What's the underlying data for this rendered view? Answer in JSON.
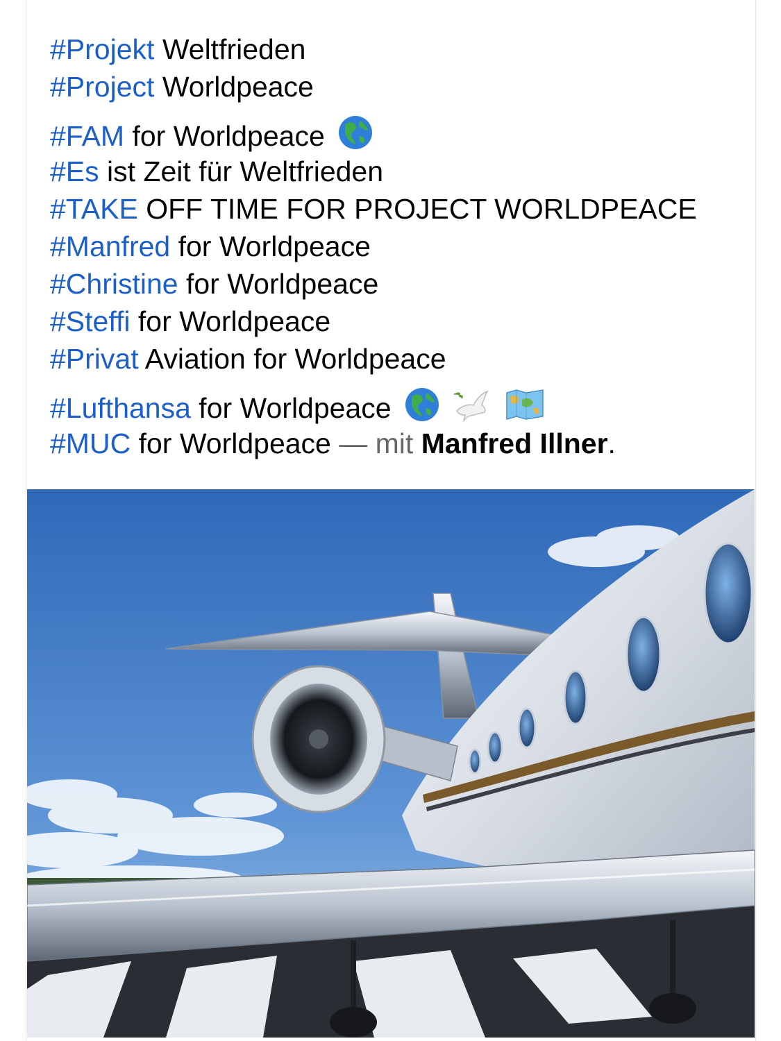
{
  "post": {
    "lines": [
      {
        "tag": "#Projekt",
        "rest": " Weltfrieden"
      },
      {
        "tag": "#Project",
        "rest": " Worldpeace"
      },
      {
        "tag": "#FAM",
        "rest": " for Worldpeace",
        "emojis": [
          "globe-americas-icon"
        ]
      },
      {
        "tag": "#Es",
        "rest": " ist Zeit für Weltfrieden"
      },
      {
        "tag": "#TAKE",
        "rest": " OFF TIME FOR PROJECT WORLDPEACE"
      },
      {
        "tag": "#Manfred",
        "rest": " for Worldpeace"
      },
      {
        "tag": "#Christine",
        "rest": " for Worldpeace"
      },
      {
        "tag": "#Steffi",
        "rest": " for Worldpeace"
      },
      {
        "tag": "#Privat",
        "rest": " Aviation for Worldpeace"
      },
      {
        "tag": "#Lufthansa",
        "rest": " for Worldpeace",
        "emojis": [
          "globe-americas-icon",
          "dove-icon",
          "world-map-icon"
        ]
      },
      {
        "tag": "#MUC",
        "rest": " for Worldpeace ",
        "with_prefix": "— mit",
        "with_name": "Manfred Illner",
        "end": "."
      }
    ]
  },
  "photo": {
    "subject": "private-jet-on-tarmac",
    "colors": {
      "sky": "#3b74c4",
      "fuselage": "#e8ecf2",
      "stripe": "#7a5a2a",
      "tarmac": "#2a2d33"
    }
  }
}
